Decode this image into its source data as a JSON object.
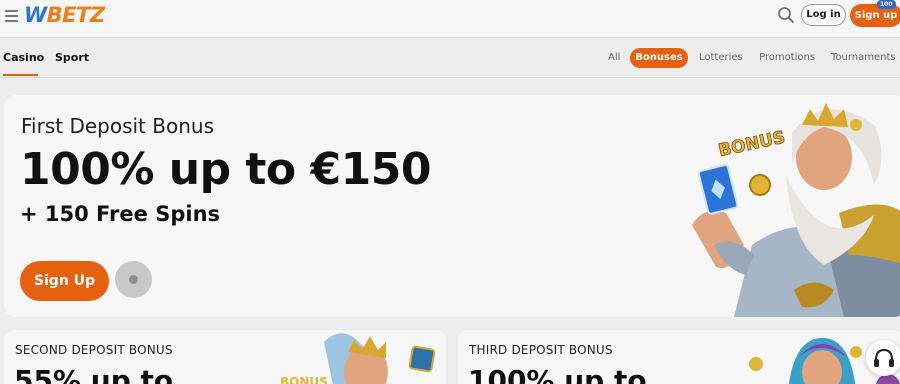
{
  "header": {
    "logo_prefix": "W",
    "logo_rest": "BETZ",
    "login_label": "Log in",
    "signup_label": "Sign up",
    "signup_badge": "100"
  },
  "nav": {
    "tabs": [
      {
        "label": "Casino",
        "active": true
      },
      {
        "label": "Sport",
        "active": false
      }
    ],
    "filters": [
      {
        "label": "All",
        "active": false
      },
      {
        "label": "Bonuses",
        "active": true
      },
      {
        "label": "Lotteries",
        "active": false
      },
      {
        "label": "Promotions",
        "active": false
      },
      {
        "label": "Tournaments",
        "active": false
      }
    ]
  },
  "hero": {
    "kicker": "First Deposit Bonus",
    "title": "100% up to €150",
    "subtitle": "+ 150 Free Spins",
    "cta_label": "Sign Up",
    "art_text": "BONUS"
  },
  "cards": [
    {
      "kicker": "SECOND DEPOSIT BONUS",
      "title": "55% up to",
      "art_text": "BONUS"
    },
    {
      "kicker": "THIRD DEPOSIT BONUS",
      "title": "100% up to"
    }
  ],
  "icons": {
    "menu": "hamburger-menu-icon",
    "search": "search-icon",
    "info": "info-icon",
    "support": "headset-icon"
  },
  "colors": {
    "accent": "#e5600f",
    "logo_blue": "#2f77c8",
    "logo_orange": "#ef7d1a",
    "badge": "#3467c7"
  }
}
